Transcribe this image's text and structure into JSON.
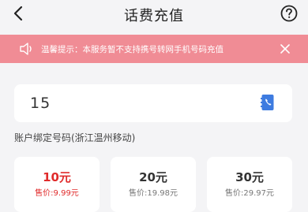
{
  "header": {
    "title": "话费充值",
    "back_icon": "chevron-left-icon",
    "help_icon": "question-circle-icon"
  },
  "notice": {
    "text": "温馨提示：本服务暂不支持携号转网手机号码充值",
    "background": "#f08c95",
    "icon": "speaker-icon",
    "close_icon": "close-icon"
  },
  "phone": {
    "value": "15",
    "contact_icon": "contact-book-icon"
  },
  "bind_label": "账户绑定号码(浙江温州移动)",
  "amounts": [
    {
      "face": "10元",
      "price": "售价:9.99元",
      "selected": true
    },
    {
      "face": "20元",
      "price": "售价:19.98元",
      "selected": false
    },
    {
      "face": "30元",
      "price": "售价:29.97元",
      "selected": false
    }
  ],
  "colors": {
    "accent_red": "#e02b2b",
    "page_bg": "#f4f4f6"
  }
}
